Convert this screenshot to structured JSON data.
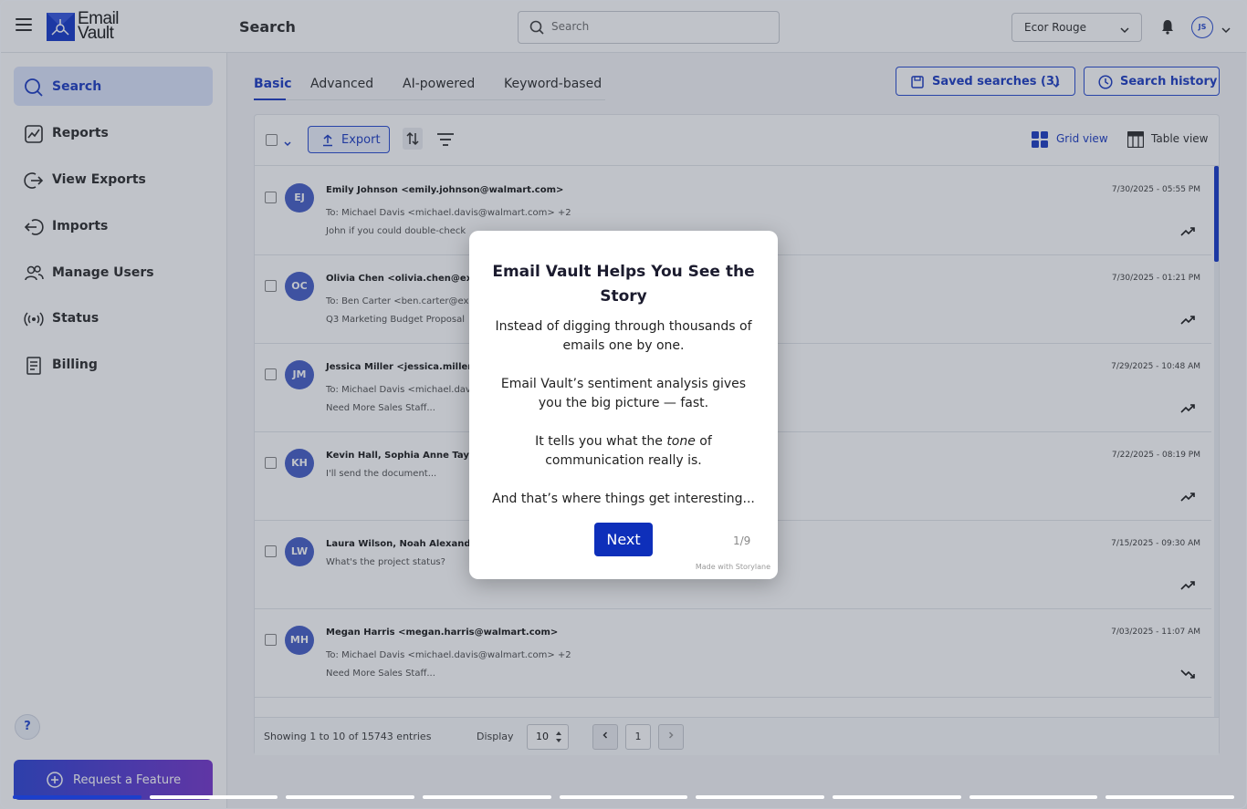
{
  "header": {
    "logo_line1": "Email",
    "logo_line2": "Vault",
    "page_title": "Search",
    "search_placeholder": "Search",
    "org_name": "Ecor Rouge",
    "user_initials": "JS"
  },
  "sidebar": {
    "items": [
      {
        "label": "Search",
        "icon": "search-icon",
        "active": true
      },
      {
        "label": "Reports",
        "icon": "reports-icon"
      },
      {
        "label": "View Exports",
        "icon": "exports-icon"
      },
      {
        "label": "Imports",
        "icon": "imports-icon"
      },
      {
        "label": "Manage Users",
        "icon": "users-icon"
      },
      {
        "label": "Status",
        "icon": "status-icon"
      },
      {
        "label": "Billing",
        "icon": "billing-icon"
      }
    ],
    "help_label": "?",
    "feature_button": "Request a Feature"
  },
  "tabs": [
    {
      "label": "Basic",
      "active": true
    },
    {
      "label": "Advanced"
    },
    {
      "label": "AI-powered"
    },
    {
      "label": "Keyword-based"
    }
  ],
  "actions": {
    "saved_searches": "Saved searches (3)",
    "search_history": "Search history"
  },
  "toolbar": {
    "export": "Export",
    "grid_view": "Grid view",
    "table_view": "Table view"
  },
  "emails": [
    {
      "initials": "EJ",
      "from": "Emily Johnson <emily.johnson@walmart.com>",
      "to": "To: Michael Davis <michael.davis@walmart.com> +2",
      "subject": "John if you could double-check",
      "date": "7/30/2025 - 05:55 PM",
      "trend": "up"
    },
    {
      "initials": "OC",
      "from": "Olivia Chen <olivia.chen@examp",
      "to": "To: Ben Carter <ben.carter@exa",
      "subject": "Q3 Marketing Budget Proposal",
      "date": "7/30/2025 - 01:21 PM",
      "trend": "up"
    },
    {
      "initials": "JM",
      "from": "Jessica Miller <jessica.millerh@",
      "to": "To: Michael Davis <michael.davis",
      "subject": "Need More Sales Staff...",
      "date": "7/29/2025 - 10:48 AM",
      "trend": "up"
    },
    {
      "initials": "KH",
      "from": "Kevin Hall, Sophia Anne Taylor",
      "to": "",
      "subject": "I'll send the document...",
      "date": "7/22/2025 - 08:19 PM",
      "trend": "up"
    },
    {
      "initials": "LW",
      "from": "Laura Wilson, Noah Alexander...",
      "to": "",
      "subject": "What's the project status?",
      "date": "7/15/2025 - 09:30 AM",
      "trend": "up"
    },
    {
      "initials": "MH",
      "from": "Megan Harris <megan.harris@walmart.com>",
      "to": "To: Michael Davis <michael.davis@walmart.com> +2",
      "subject": "Need More Sales Staff...",
      "date": "7/03/2025 - 11:07 AM",
      "trend": "down"
    }
  ],
  "footer": {
    "showing": "Showing 1 to 10 of 15743 entries",
    "display_label": "Display",
    "display_value": "10",
    "page": "1"
  },
  "tour": {
    "title": "Email Vault Helps You See the Story",
    "p1": "Instead of digging through thousands of emails one by one.",
    "p2": "Email Vault’s sentiment analysis gives you the big picture — fast.",
    "p3_before": "It tells you what the ",
    "p3_em": "tone",
    "p3_after": " of communication really is.",
    "p4": "And that’s where things get interesting...",
    "next": "Next",
    "step": "1/9",
    "made_with": "Made with Storylane",
    "progress_current": 1,
    "progress_total": 9
  },
  "colors": {
    "accent": "#1c3fcb",
    "accent_text": "#2342c4",
    "avatar": "#4b63c8"
  }
}
